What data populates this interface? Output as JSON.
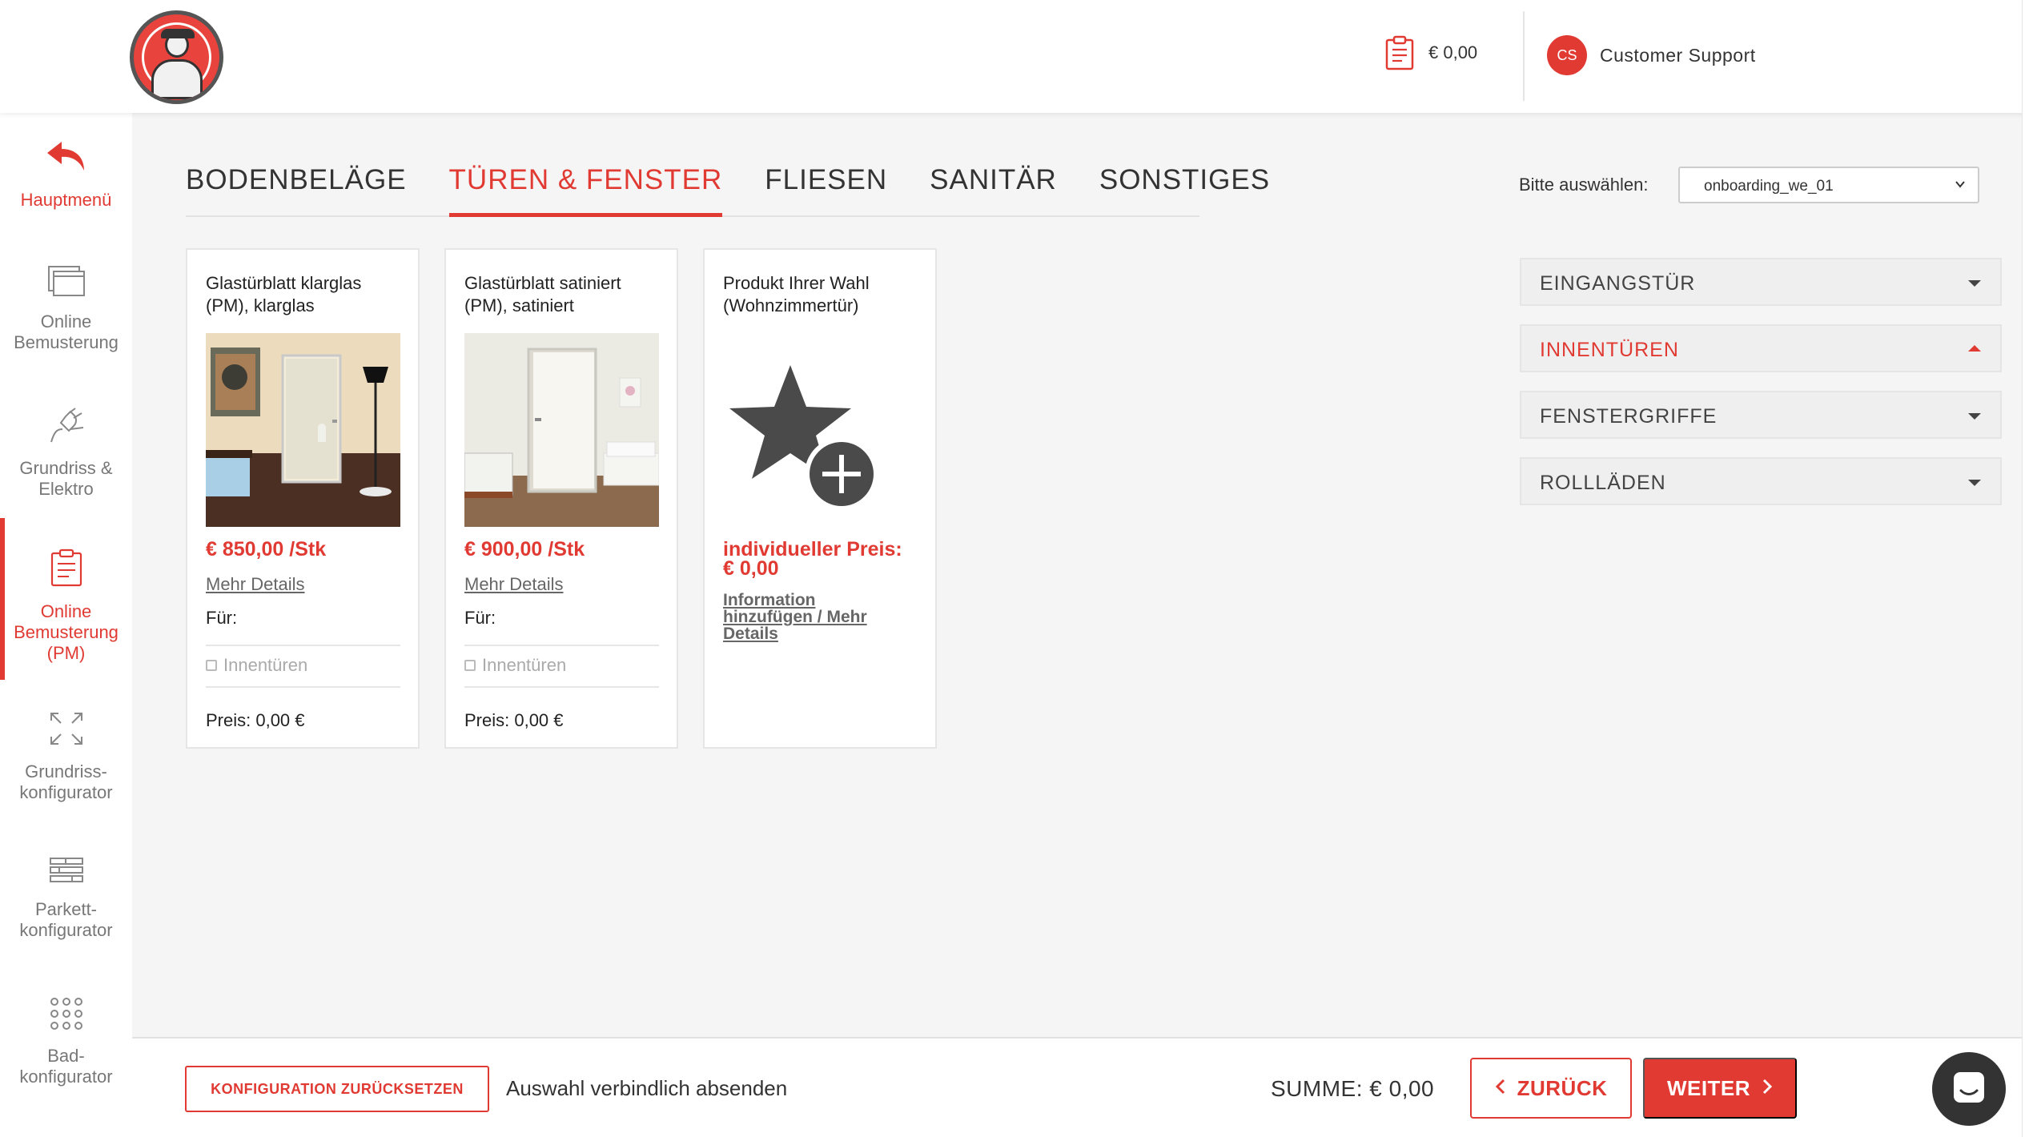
{
  "header": {
    "cart_amount": "€ 0,00",
    "support_initials": "CS",
    "support_name": "Customer Support"
  },
  "sidebar": {
    "items": [
      {
        "label_1": "Hauptmenü",
        "label_2": "",
        "label_3": "",
        "icon": "back-arrow-icon"
      },
      {
        "label_1": "Online",
        "label_2": "Bemusterung",
        "label_3": "",
        "icon": "window-icon"
      },
      {
        "label_1": "Grundriss &",
        "label_2": "Elektro",
        "label_3": "",
        "icon": "plug-icon"
      },
      {
        "label_1": "Online",
        "label_2": "Bemusterung",
        "label_3": "(PM)",
        "icon": "clipboard-icon"
      },
      {
        "label_1": "Grundriss-",
        "label_2": "konfigurator",
        "label_3": "",
        "icon": "expand-icon"
      },
      {
        "label_1": "Parkett-",
        "label_2": "konfigurator",
        "label_3": "",
        "icon": "parquet-icon"
      },
      {
        "label_1": "Bad-",
        "label_2": "konfigurator",
        "label_3": "",
        "icon": "grid-dots-icon"
      }
    ]
  },
  "tabs": [
    {
      "label": "BODENBELÄGE"
    },
    {
      "label": "TÜREN & FENSTER"
    },
    {
      "label": "FLIESEN"
    },
    {
      "label": "SANITÄR"
    },
    {
      "label": "SONSTIGES"
    }
  ],
  "active_tab": "TÜREN & FENSTER",
  "select": {
    "label": "Bitte auswählen:",
    "value": "onboarding_we_01"
  },
  "cards": [
    {
      "title_1": "Glastürblatt klarglas",
      "title_2": "(PM), klarglas",
      "price": "€ 850,00 /Stk",
      "link": "Mehr Details",
      "fuer": "Für:",
      "check_label": "Innentüren",
      "preis": "Preis: 0,00 €"
    },
    {
      "title_1": "Glastürblatt satiniert",
      "title_2": "(PM), satiniert",
      "price": "€ 900,00 /Stk",
      "link": "Mehr Details",
      "fuer": "Für:",
      "check_label": "Innentüren",
      "preis": "Preis: 0,00 €"
    },
    {
      "title_1": "Produkt Ihrer Wahl",
      "title_2": "(Wohnzimmertür)",
      "price_1": "individueller Preis:",
      "price_2": "€ 0,00",
      "link_1": "Information",
      "link_2": "hinzufügen / Mehr",
      "link_3": "Details"
    }
  ],
  "accordion": [
    {
      "label": "EINGANGSTÜR",
      "open": false
    },
    {
      "label": "INNENTÜREN",
      "open": true
    },
    {
      "label": "FENSTERGRIFFE",
      "open": false
    },
    {
      "label": "ROLLLÄDEN",
      "open": false
    }
  ],
  "footer": {
    "reset_label": "KONFIGURATION ZURÜCKSETZEN",
    "submit_text": "Auswahl verbindlich absenden",
    "summe": "SUMME: € 0,00",
    "back_label": "ZURÜCK",
    "next_label": "WEITER"
  },
  "colors": {
    "accent": "#e03a33",
    "text": "#333333",
    "muted": "#777777",
    "background": "#f5f5f5"
  }
}
